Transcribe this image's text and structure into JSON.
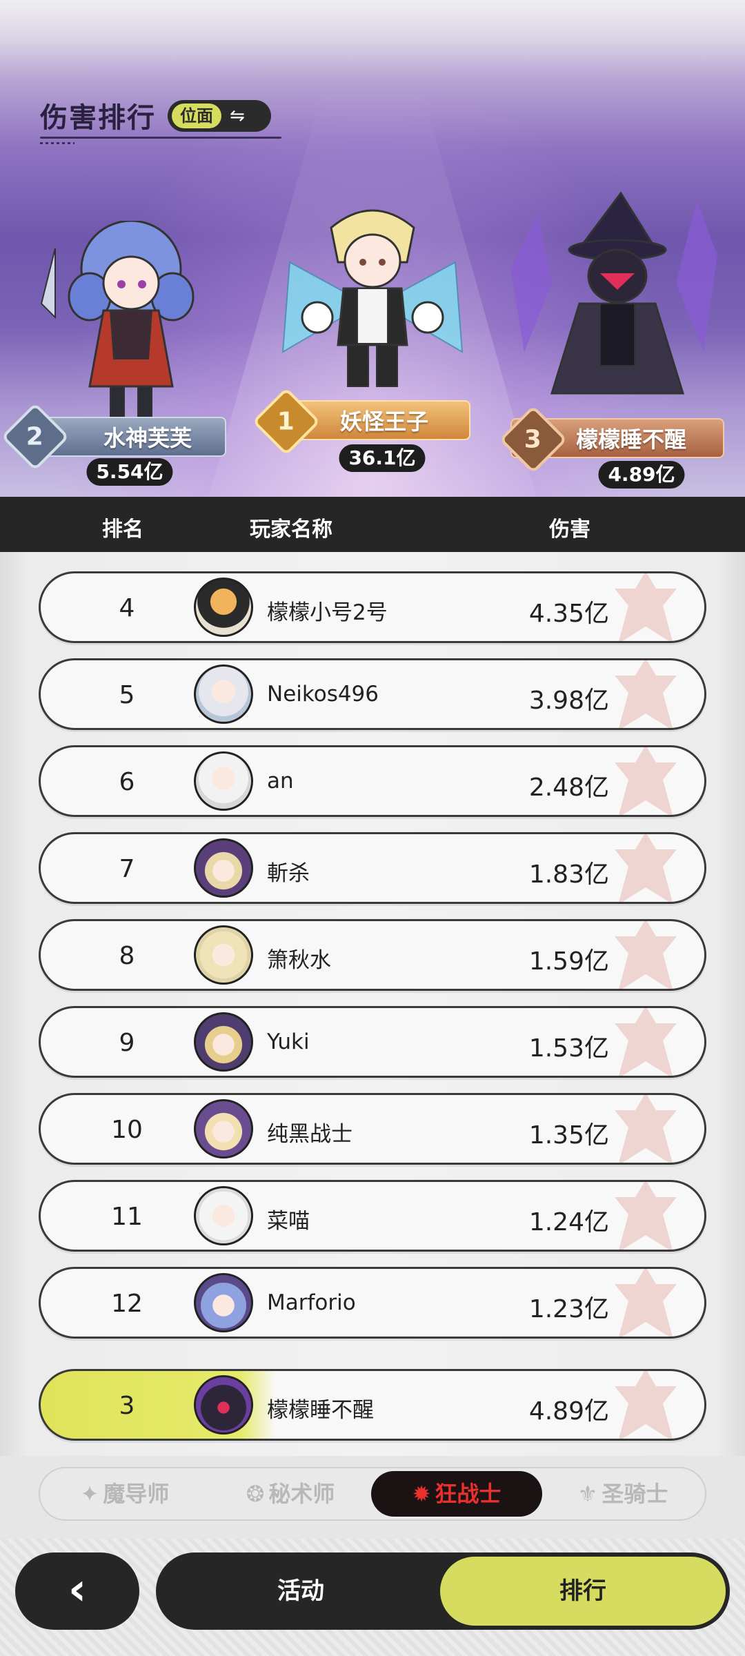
{
  "header": {
    "title": "伤害排行",
    "plane_toggle_label": "位面",
    "swap_glyph": "⇋"
  },
  "podium": [
    {
      "rank": "2",
      "name": "水神芙芙",
      "damage": "5.54亿"
    },
    {
      "rank": "1",
      "name": "妖怪王子",
      "damage": "36.1亿"
    },
    {
      "rank": "3",
      "name": "檬檬睡不醒",
      "damage": "4.89亿"
    }
  ],
  "table_header": {
    "rank": "排名",
    "player": "玩家名称",
    "damage": "伤害"
  },
  "rows": [
    {
      "rank": "4",
      "name": "檬檬小号2号",
      "damage": "4.35亿"
    },
    {
      "rank": "5",
      "name": "Neikos496",
      "damage": "3.98亿"
    },
    {
      "rank": "6",
      "name": "an",
      "damage": "2.48亿"
    },
    {
      "rank": "7",
      "name": "斬杀",
      "damage": "1.83亿"
    },
    {
      "rank": "8",
      "name": "箫秋水",
      "damage": "1.59亿"
    },
    {
      "rank": "9",
      "name": "Yuki",
      "damage": "1.53亿"
    },
    {
      "rank": "10",
      "name": "纯黑战士",
      "damage": "1.35亿"
    },
    {
      "rank": "11",
      "name": "菜喵",
      "damage": "1.24亿"
    },
    {
      "rank": "12",
      "name": "Marforio",
      "damage": "1.23亿"
    }
  ],
  "my_row": {
    "rank": "3",
    "name": "檬檬睡不醒",
    "damage": "4.89亿"
  },
  "class_tabs": [
    {
      "label": "魔导师"
    },
    {
      "label": "秘术师"
    },
    {
      "label": "狂战士",
      "active": true
    },
    {
      "label": "圣骑士"
    }
  ],
  "bottom_nav": {
    "back_glyph": "‹",
    "activity": "活动",
    "ranking": "排行"
  },
  "colors": {
    "accent_lime": "#d6dc60",
    "dark": "#262626",
    "active_tab_text": "#e8302d"
  }
}
